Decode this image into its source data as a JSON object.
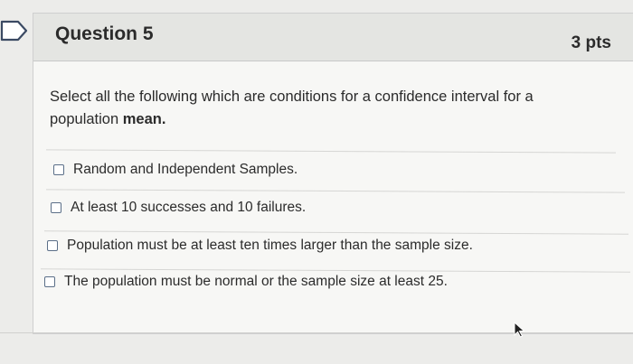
{
  "question": {
    "title": "Question 5",
    "points": "3 pts",
    "prompt_main": "Select all the following which are conditions for a confidence interval for a population",
    "prompt_bold": "mean."
  },
  "answers": [
    {
      "label": "Random and Independent Samples."
    },
    {
      "label": "At least 10 successes and 10 failures."
    },
    {
      "label": "Population must be at least ten times larger than the sample size."
    },
    {
      "label": "The population must be normal or the sample size at least 25."
    }
  ],
  "icons": {
    "flag": "bookmark-flag-icon",
    "checkbox": "checkbox-icon",
    "cursor": "mouse-pointer-icon"
  },
  "colors": {
    "header_bg": "#e4e5e2",
    "card_bg": "#f7f7f5",
    "text": "#2b2b2b",
    "flag_stroke": "#3b4a63"
  }
}
